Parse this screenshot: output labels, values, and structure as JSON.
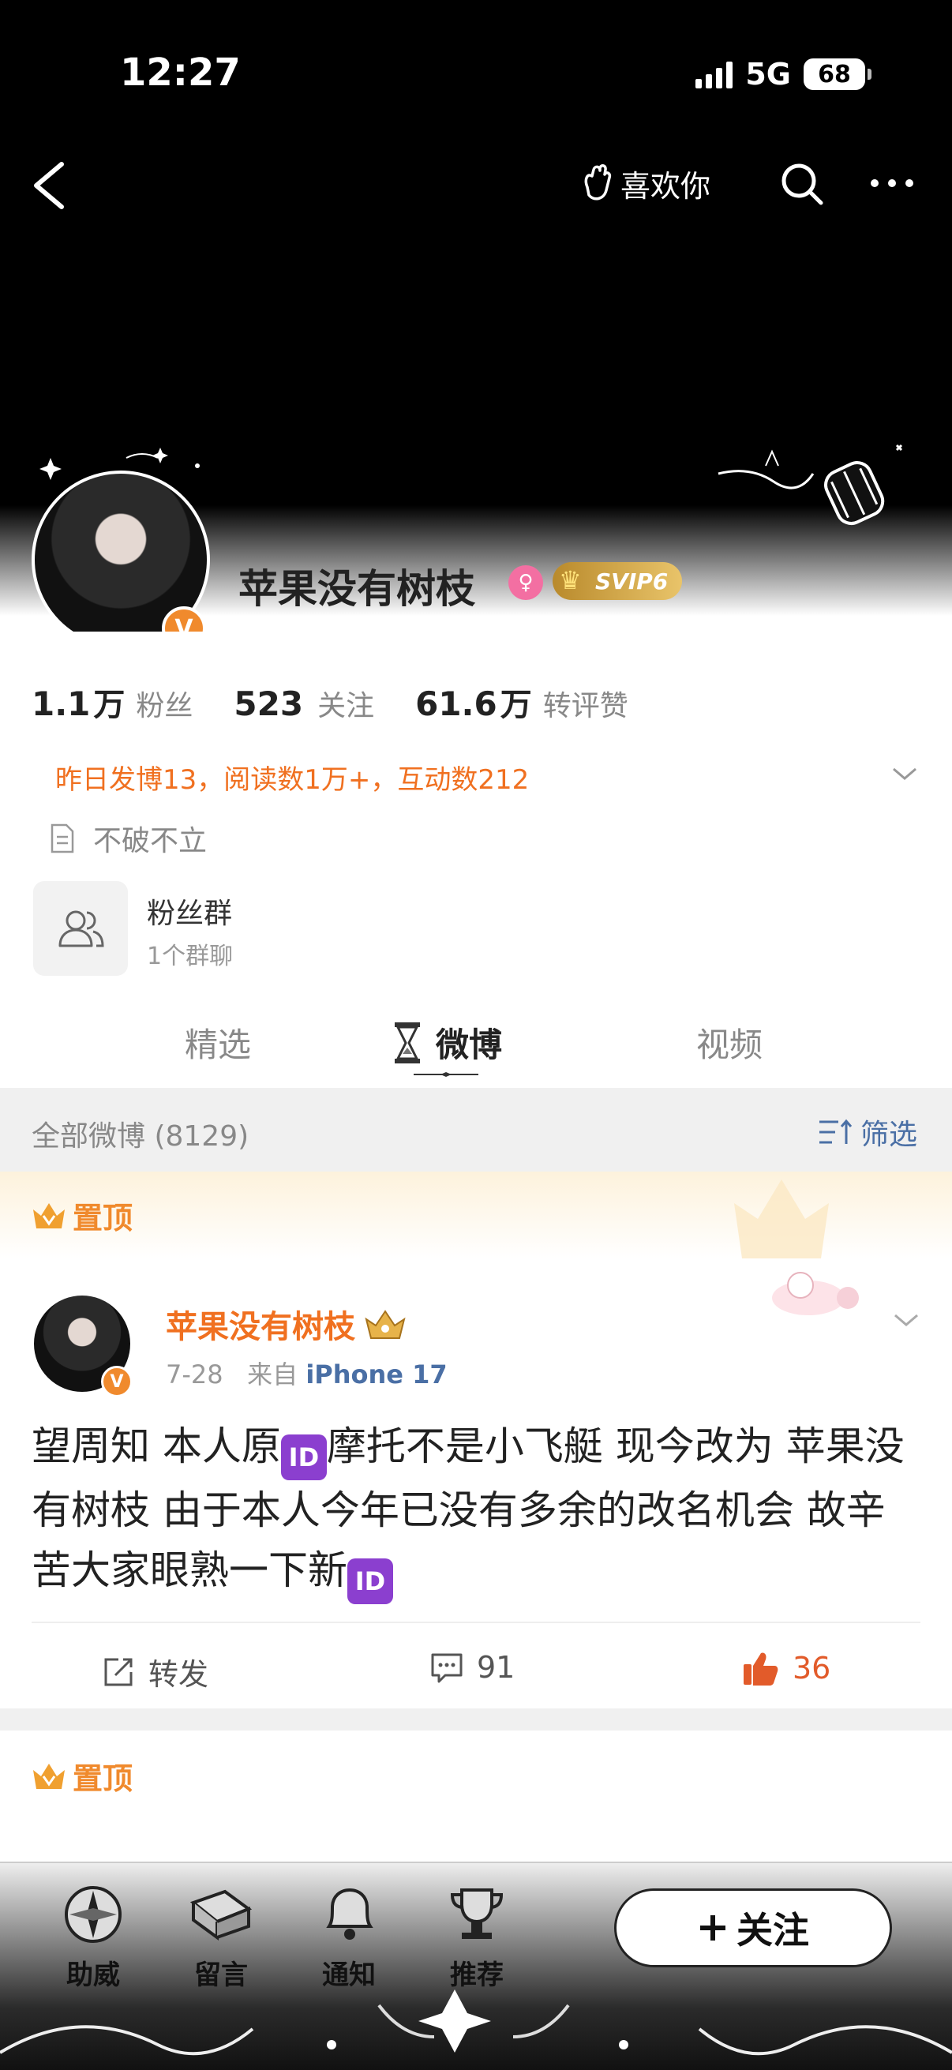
{
  "status": {
    "time": "12:27",
    "network": "5G",
    "battery": "68"
  },
  "nav": {
    "like_you": "喜欢你"
  },
  "profile": {
    "name": "苹果没有树枝",
    "svip": "SVIP6",
    "stats": [
      {
        "num": "1.1",
        "unit": "万",
        "label": "粉丝"
      },
      {
        "num": "523",
        "unit": "",
        "label": "关注"
      },
      {
        "num": "61.6",
        "unit": "万",
        "label": "转评赞"
      }
    ],
    "activity": "昨日发博13，阅读数1万+，互动数212",
    "bio": "不破不立",
    "fans_group": {
      "title": "粉丝群",
      "subtitle": "1个群聊"
    }
  },
  "tabs": [
    {
      "label": "精选"
    },
    {
      "label": "微博"
    },
    {
      "label": "视频"
    }
  ],
  "feed": {
    "count_label": "全部微博 (8129)",
    "filter_label": "筛选"
  },
  "post": {
    "pinned_label": "置顶",
    "author": "苹果没有树枝",
    "date": "7-28",
    "source_prefix": "来自",
    "device": "iPhone 17",
    "text_parts": [
      "望周知 本人原",
      "摩托不是小飞艇 现今改为 苹果没有树枝 由于本人今年已没有多余的改名机会 故辛苦大家眼熟一下新",
      ""
    ],
    "id_emoji": "ID",
    "repost_label": "转发",
    "comments": "91",
    "likes": "36"
  },
  "post2": {
    "pinned_label": "置顶"
  },
  "bottom": {
    "items": [
      {
        "label": "助威"
      },
      {
        "label": "留言"
      },
      {
        "label": "通知"
      },
      {
        "label": "推荐"
      }
    ],
    "follow_label": "关注"
  }
}
